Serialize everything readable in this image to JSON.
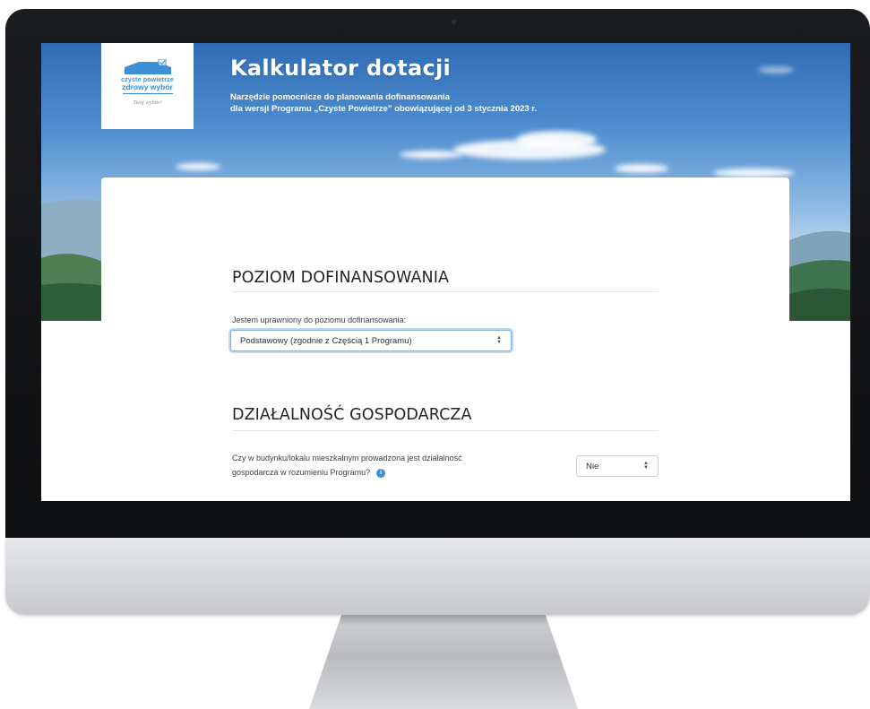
{
  "app": {
    "logo": {
      "line1": "czyste powietrze",
      "line2": "zdrowy wybór",
      "tagline": "Twój wybór!"
    },
    "title": "Kalkulator dotacji",
    "subtitle_line1": "Narzędzie pomocnicze do planowania dofinansowania",
    "subtitle_line2": "dla wersji Programu „Czyste Powietrze” obowiązującej od 3 stycznia 2023 r."
  },
  "sections": {
    "funding_level": {
      "heading": "POZIOM DOFINANSOWANIA",
      "label": "Jestem uprawniony do poziomu dofinansowania:",
      "selected": "Podstawowy (zgodnie z Częścią 1 Programu)"
    },
    "business": {
      "heading": "DZIAŁALNOŚĆ GOSPODARCZA",
      "question_line1": "Czy w budynku/lokalu mieszkalnym prowadzona jest działalność",
      "question_line2": "gospodarcza w rozumieniu Programu?",
      "selected": "Nie"
    }
  },
  "colors": {
    "accent": "#3d8fd6",
    "sky_top": "#2f6cb5",
    "heading": "#222529"
  },
  "icons": {
    "info": "info-icon",
    "select_arrow": "select-arrows-icon",
    "logo_house": "house-check-icon"
  }
}
